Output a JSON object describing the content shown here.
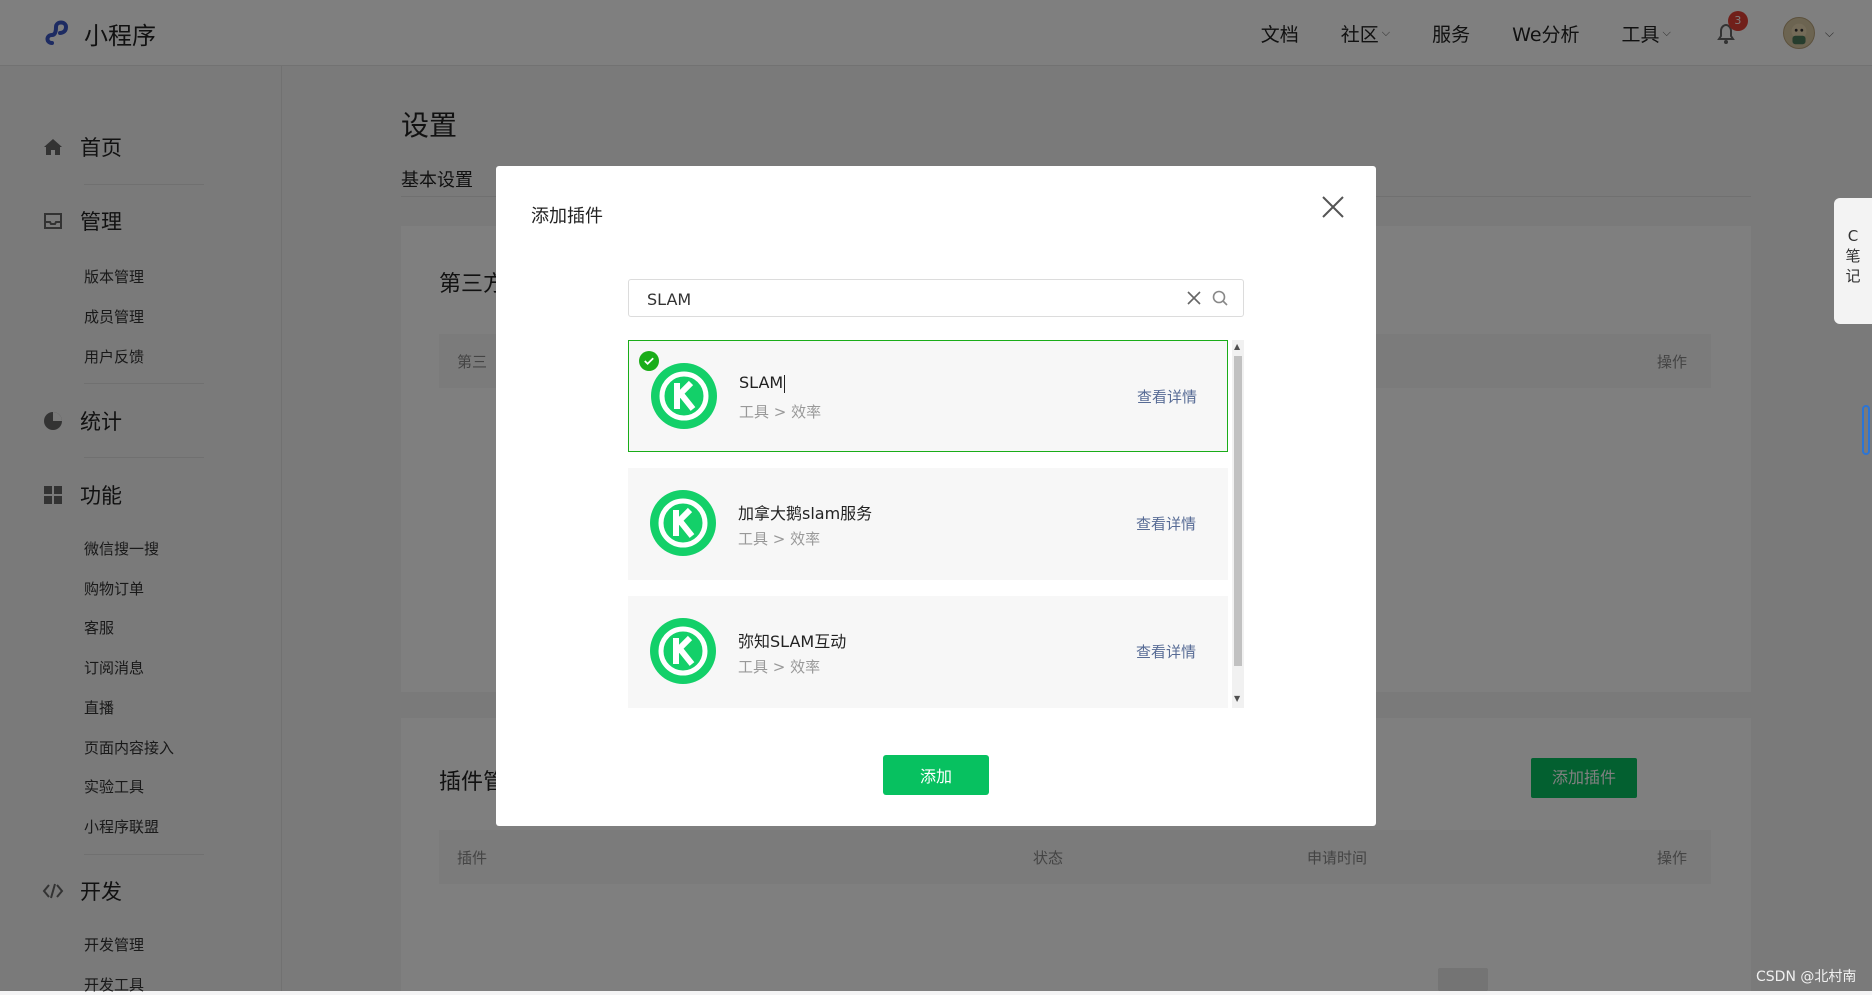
{
  "app": {
    "logo_text": "小程序"
  },
  "topnav": {
    "items": [
      {
        "label": "文档",
        "has_caret": false
      },
      {
        "label": "社区",
        "has_caret": true
      },
      {
        "label": "服务",
        "has_caret": false
      },
      {
        "label": "We分析",
        "has_caret": false
      },
      {
        "label": "工具",
        "has_caret": true
      }
    ],
    "notification_count": "3"
  },
  "sidebar": {
    "home": "首页",
    "manage": "管理",
    "manage_items": [
      "版本管理",
      "成员管理",
      "用户反馈"
    ],
    "stats": "统计",
    "features": "功能",
    "feature_items": [
      "微信搜一搜",
      "购物订单",
      "客服",
      "订阅消息",
      "直播",
      "页面内容接入",
      "实验工具",
      "小程序联盟"
    ],
    "dev": "开发",
    "dev_items": [
      "开发管理",
      "开发工具"
    ]
  },
  "main": {
    "title": "设置",
    "tab": "基本设置",
    "section1_title": "第三方",
    "section1_col_first": "第三",
    "section1_col_action": "操作",
    "section2_title": "插件管",
    "add_plugin_button": "添加插件",
    "table2_cols": {
      "plugin": "插件",
      "status": "状态",
      "apply_time": "申请时间",
      "action": "操作"
    }
  },
  "widget": {
    "text": [
      "C",
      "笔",
      "记"
    ]
  },
  "modal": {
    "title": "添加插件",
    "search_value": "SLAM",
    "plugins": [
      {
        "name": "SLAM",
        "category": "工具 > 效率",
        "detail": "查看详情",
        "selected": true
      },
      {
        "name": "加拿大鹅slam服务",
        "category": "工具 > 效率",
        "detail": "查看详情",
        "selected": false
      },
      {
        "name": "弥知SLAM互动",
        "category": "工具 > 效率",
        "detail": "查看详情",
        "selected": false
      }
    ],
    "add_button": "添加"
  },
  "watermark": "CSDN @北村南",
  "colors": {
    "brand_green": "#07c160",
    "selected_border": "#1aad19",
    "link": "#576b95",
    "badge": "#e24135"
  }
}
